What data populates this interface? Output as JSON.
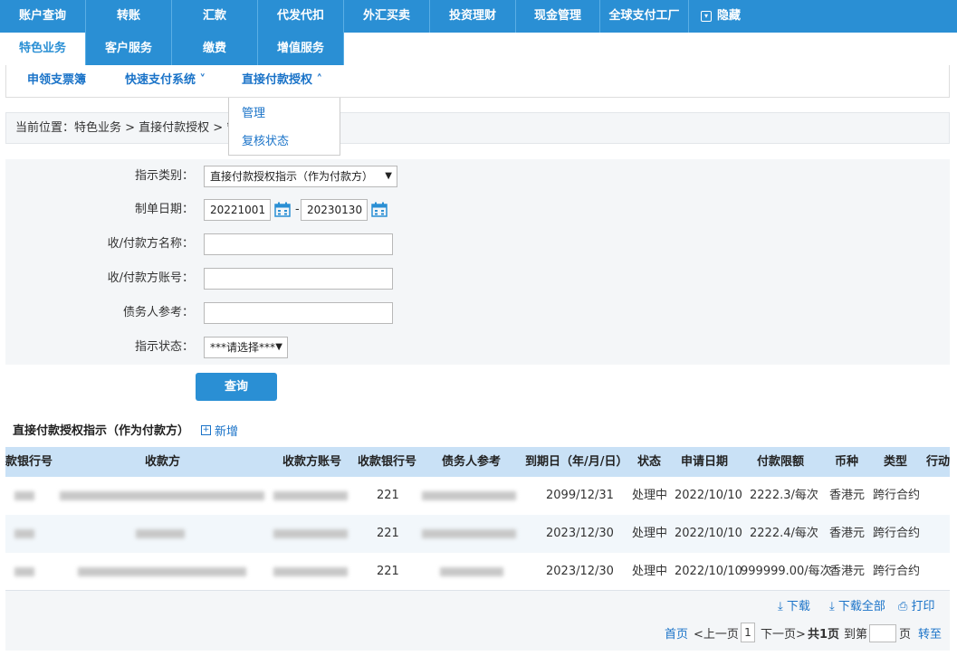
{
  "nav": {
    "row1": [
      "账户查询",
      "转账",
      "汇款",
      "代发代扣",
      "外汇买卖",
      "投资理财",
      "现金管理",
      "全球支付工厂"
    ],
    "hide_label": "隐藏",
    "row2": [
      "特色业务",
      "客户服务",
      "缴费",
      "增值服务"
    ]
  },
  "subnav": {
    "items": [
      "申领支票簿",
      "快速支付系统 ˅",
      "直接付款授权 ˄"
    ]
  },
  "dropdown": {
    "items": [
      "管理",
      "复核状态"
    ]
  },
  "breadcrumb": "当前位置：特色业务 > 直接付款授权 > 管理",
  "form": {
    "type_label": "指示类别：",
    "type_value": "直接付款授权指示（作为付款方）",
    "date_label": "制单日期：",
    "date_from": "20221001",
    "date_to": "20230130",
    "date_sep": "-",
    "name_label": "收/付款方名称：",
    "account_label": "收/付款方账号：",
    "ref_label": "债务人参考：",
    "status_label": "指示状态：",
    "status_value": "***请选择***",
    "query_button": "查询"
  },
  "section": {
    "title": "直接付款授权指示（作为付款方）",
    "add_label": "新增"
  },
  "table": {
    "headers": [
      "款银行号",
      "收款方",
      "收款方账号",
      "收款银行号",
      "债务人参考",
      "到期日（年/月/日）",
      "状态",
      "申请日期",
      "付款限额",
      "币种",
      "类型",
      "行动"
    ],
    "rows": [
      {
        "bank": "221",
        "due": "2099/12/31",
        "status": "处理中",
        "apply": "2022/10/10",
        "limit": "2222.3/每次",
        "currency": "香港元",
        "type": "跨行合约"
      },
      {
        "bank": "221",
        "due": "2023/12/30",
        "status": "处理中",
        "apply": "2022/10/10",
        "limit": "2222.4/每次",
        "currency": "香港元",
        "type": "跨行合约"
      },
      {
        "bank": "221",
        "due": "2023/12/30",
        "status": "处理中",
        "apply": "2022/10/10",
        "limit": "999999.00/每次",
        "currency": "香港元",
        "type": "跨行合约"
      }
    ]
  },
  "footer": {
    "download": "下载",
    "download_all": "下载全部",
    "print": "打印",
    "first": "首页",
    "prev": "<上一页",
    "page": "1",
    "next": "下一页>",
    "total": "共1页",
    "goto": "到第",
    "page_unit": "页",
    "jump": "转至"
  },
  "colors": {
    "nav_blue": "#2a8fd4",
    "link_blue": "#1a73c8",
    "header_bg": "#c9e1f6"
  }
}
